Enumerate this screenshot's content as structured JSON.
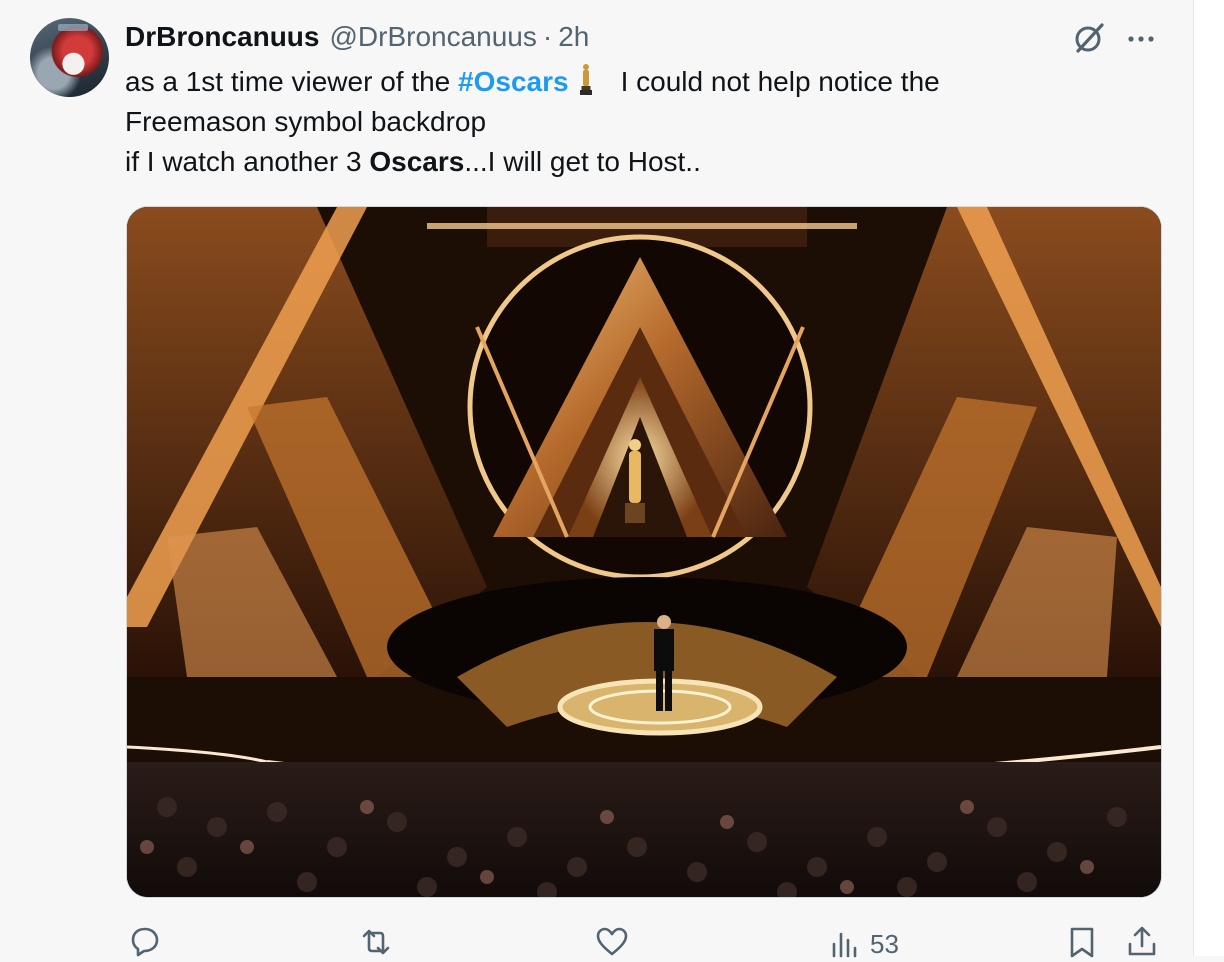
{
  "tweet": {
    "display_name": "DrBroncanuus",
    "handle": "@DrBroncanuus",
    "separator": "·",
    "time": "2h",
    "text_line1_prefix": "as a 1st time viewer of the",
    "hashtag": "#Oscars",
    "text_line1_suffix": "I could not help notice the",
    "text_line2": "Freemason symbol backdrop",
    "text_line3_prefix": "if I watch another 3",
    "text_line3_bold": "Oscars",
    "text_line3_suffix": "...I will get to Host.."
  },
  "actions": {
    "views_count": "53"
  },
  "icons": {
    "reply": "reply-icon",
    "retweet": "retweet-icon",
    "like": "like-icon",
    "views": "views-icon",
    "bookmark": "bookmark-icon",
    "share": "share-icon",
    "grok": "grok-icon",
    "more": "more-icon"
  },
  "colors": {
    "accent": "#1d9bf0",
    "text_primary": "#0f1419",
    "text_secondary": "#536471",
    "background": "#f7f7f7"
  }
}
